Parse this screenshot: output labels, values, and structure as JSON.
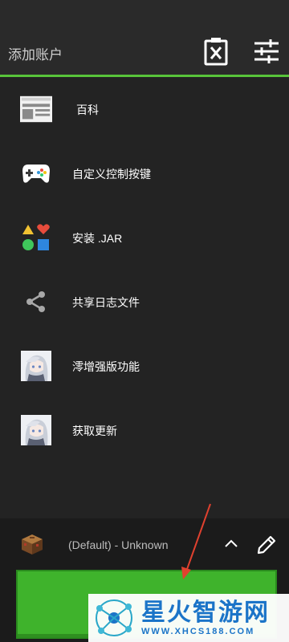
{
  "header": {
    "title": "添加账户"
  },
  "menu": {
    "items": [
      {
        "label": "百科",
        "icon": "wiki-icon"
      },
      {
        "label": "自定义控制按键",
        "icon": "gamepad-icon"
      },
      {
        "label": "安装 .JAR",
        "icon": "shapes-icon"
      },
      {
        "label": "共享日志文件",
        "icon": "share-icon"
      },
      {
        "label": "澪增强版功能",
        "icon": "anime-avatar-icon"
      },
      {
        "label": "获取更新",
        "icon": "anime-avatar-icon"
      }
    ]
  },
  "bottom": {
    "profile_name": "(Default) - Unknown",
    "play_color": "#3fb32c"
  },
  "watermark": {
    "big": "星火智游网",
    "small": "WWW.XHCS188.COM"
  }
}
